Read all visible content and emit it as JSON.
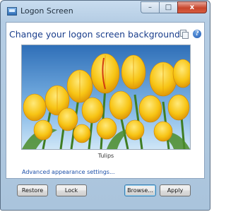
{
  "window": {
    "title": "Logon Screen"
  },
  "caption_buttons": {
    "minimize": "–",
    "maximize": "□",
    "close": "x"
  },
  "header": {
    "heading": "Change your logon screen background",
    "help_icon": "?"
  },
  "preview": {
    "image_caption": "Tulips",
    "image_colors": [
      "#f6c21a",
      "#3a7fc4",
      "#2f6b2a"
    ]
  },
  "links": {
    "advanced": "Advanced appearance settings..."
  },
  "buttons": {
    "restore": "Restore",
    "lock": "Lock",
    "browse": "Browse...",
    "apply": "Apply"
  },
  "icons": [
    "app-icon",
    "copy-icon",
    "help-icon"
  ]
}
